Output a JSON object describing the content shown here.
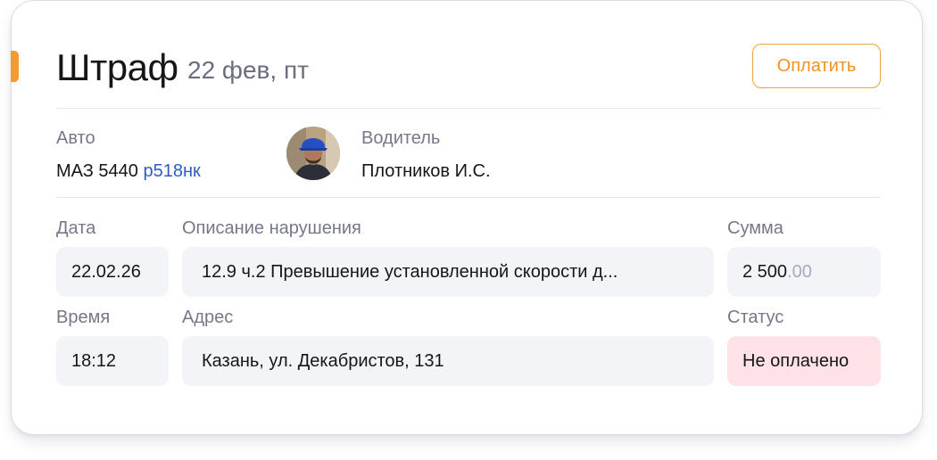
{
  "card": {
    "title": "Штраф",
    "date": "22 фев, пт",
    "pay_button_label": "Оплатить",
    "accent_color": "#f39a33"
  },
  "vehicle": {
    "label": "Авто",
    "model": "МАЗ 5440",
    "plate": "р518нк"
  },
  "driver": {
    "label": "Водитель",
    "name": "Плотников И.С.",
    "avatar_icon": "driver-avatar"
  },
  "details": {
    "date_label": "Дата",
    "date_value": "22.02.26",
    "description_label": "Описание нарушения",
    "description_value": "12.9 ч.2 Превышение установленной скорости д...",
    "amount_label": "Сумма",
    "amount_whole": "2 500",
    "amount_cents": ".00",
    "time_label": "Время",
    "time_value": "18:12",
    "address_label": "Адрес",
    "address_value": "Казань, ул. Декабристов, 131",
    "status_label": "Статус",
    "status_value": "Не оплачено",
    "status_color": "#fde3e8"
  }
}
